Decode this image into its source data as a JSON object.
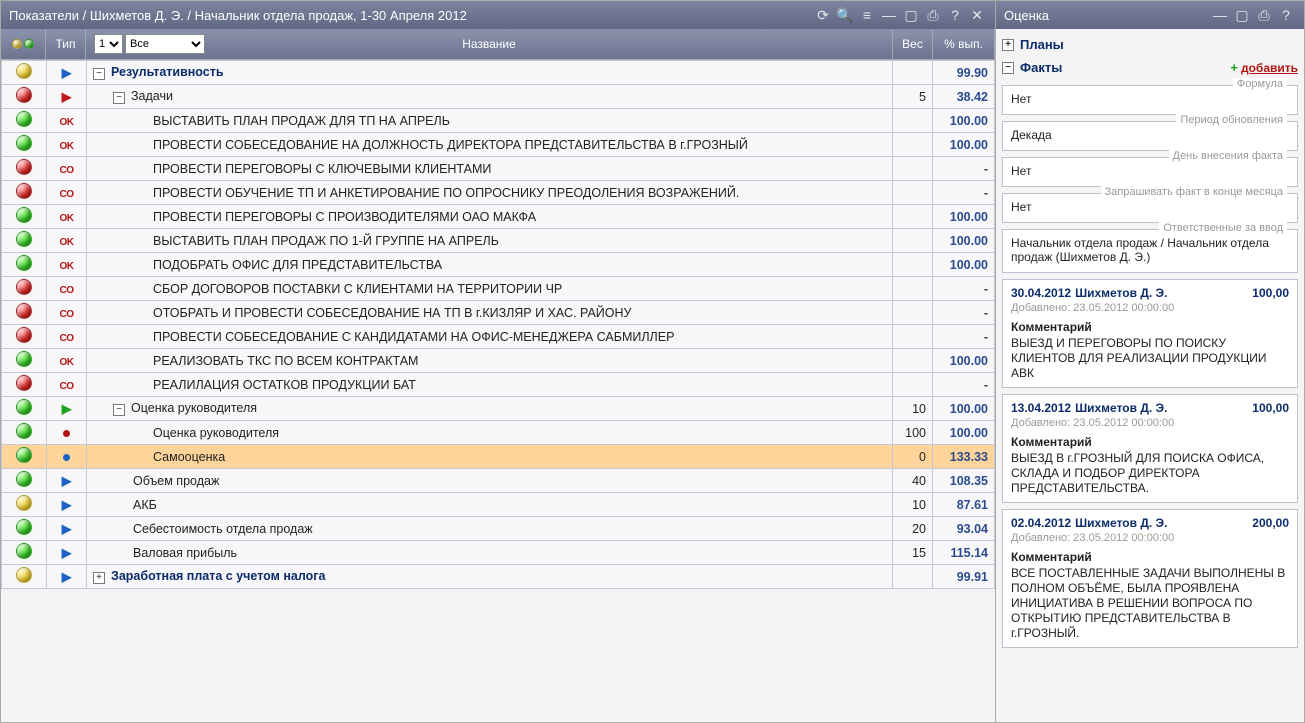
{
  "left_title": "Показатели / Шихметов Д. Э. / Начальник отдела продаж, 1-30 Апреля 2012",
  "right_title": "Оценка",
  "columns": {
    "type": "Тип",
    "name": "Название",
    "weight": "Вес",
    "pct": "% вып."
  },
  "level_select": "1",
  "filter_select": "Все",
  "plans_label": "Планы",
  "facts_label": "Факты",
  "add_link": "добавить",
  "fields": {
    "formula_label": "Формула",
    "formula_value": "Нет",
    "period_label": "Период обновления",
    "period_value": "Декада",
    "entryday_label": "День внесения факта",
    "entryday_value": "Нет",
    "eom_label": "Запрашивать факт в конце месяца",
    "eom_value": "Нет",
    "resp_label": "Ответственные за ввод",
    "resp_value": "Начальник отдела продаж / Начальник отдела продаж (Шихметов Д. Э.)"
  },
  "comment_label": "Комментарий",
  "entries": [
    {
      "date": "30.04.2012",
      "name": "Шихметов Д. Э.",
      "amount": "100,00",
      "added": "Добавлено: 23.05.2012 00:00:00",
      "comment": "ВЫЕЗД И ПЕРЕГОВОРЫ ПО ПОИСКУ КЛИЕНТОВ ДЛЯ РЕАЛИЗАЦИИ ПРОДУКЦИИ АВК"
    },
    {
      "date": "13.04.2012",
      "name": "Шихметов Д. Э.",
      "amount": "100,00",
      "added": "Добавлено: 23.05.2012 00:00:00",
      "comment": "ВЫЕЗД В г.ГРОЗНЫЙ ДЛЯ ПОИСКА ОФИСА, СКЛАДА И ПОДБОР ДИРЕКТОРА ПРЕДСТАВИТЕЛЬСТВА."
    },
    {
      "date": "02.04.2012",
      "name": "Шихметов Д. Э.",
      "amount": "200,00",
      "added": "Добавлено: 23.05.2012 00:00:00",
      "comment": "ВСЕ ПОСТАВЛЕННЫЕ ЗАДАЧИ ВЫПОЛНЕНЫ В ПОЛНОМ ОБЪЁМЕ, БЫЛА ПРОЯВЛЕНА ИНИЦИАТИВА В РЕШЕНИИ ВОПРОСА ПО ОТКРЫТИЮ ПРЕДСТАВИТЕЛЬСТВА В г.ГРОЗНЫЙ."
    }
  ],
  "rows": [
    {
      "dot": "yellow",
      "type": "play-blue",
      "indent": 0,
      "expander": "minus",
      "bold": true,
      "name": "Результативность",
      "weight": "",
      "pct": "99.90"
    },
    {
      "dot": "red",
      "type": "play-red",
      "indent": 1,
      "expander": "minus",
      "bold": false,
      "name": "Задачи",
      "weight": "5",
      "pct": "38.42"
    },
    {
      "dot": "green",
      "type": "ok",
      "indent": 3,
      "expander": "",
      "bold": false,
      "name": "ВЫСТАВИТЬ ПЛАН ПРОДАЖ ДЛЯ ТП НА АПРЕЛЬ",
      "weight": "",
      "pct": "100.00"
    },
    {
      "dot": "green",
      "type": "ok",
      "indent": 3,
      "expander": "",
      "bold": false,
      "name": "ПРОВЕСТИ СОБЕСЕДОВАНИЕ НА ДОЛЖНОСТЬ ДИРЕКТОРА ПРЕДСТАВИТЕЛЬСТВА В г.ГРОЗНЫЙ",
      "weight": "",
      "pct": "100.00"
    },
    {
      "dot": "red",
      "type": "so",
      "indent": 3,
      "expander": "",
      "bold": false,
      "name": "ПРОВЕСТИ ПЕРЕГОВОРЫ С КЛЮЧЕВЫМИ КЛИЕНТАМИ",
      "weight": "",
      "pct": "-"
    },
    {
      "dot": "red",
      "type": "so",
      "indent": 3,
      "expander": "",
      "bold": false,
      "name": "ПРОВЕСТИ ОБУЧЕНИЕ ТП И АНКЕТИРОВАНИЕ ПО ОПРОСНИКУ ПРЕОДОЛЕНИЯ ВОЗРАЖЕНИЙ.",
      "weight": "",
      "pct": "-"
    },
    {
      "dot": "green",
      "type": "ok",
      "indent": 3,
      "expander": "",
      "bold": false,
      "name": "ПРОВЕСТИ ПЕРЕГОВОРЫ С ПРОИЗВОДИТЕЛЯМИ ОАО МАКФА",
      "weight": "",
      "pct": "100.00"
    },
    {
      "dot": "green",
      "type": "ok",
      "indent": 3,
      "expander": "",
      "bold": false,
      "name": "ВЫСТАВИТЬ ПЛАН ПРОДАЖ ПО 1-Й ГРУППЕ НА АПРЕЛЬ",
      "weight": "",
      "pct": "100.00"
    },
    {
      "dot": "green",
      "type": "ok",
      "indent": 3,
      "expander": "",
      "bold": false,
      "name": "ПОДОБРАТЬ ОФИС ДЛЯ ПРЕДСТАВИТЕЛЬСТВА",
      "weight": "",
      "pct": "100.00"
    },
    {
      "dot": "red",
      "type": "so",
      "indent": 3,
      "expander": "",
      "bold": false,
      "name": "СБОР ДОГОВОРОВ ПОСТАВКИ С КЛИЕНТАМИ НА ТЕРРИТОРИИ ЧР",
      "weight": "",
      "pct": "-"
    },
    {
      "dot": "red",
      "type": "so",
      "indent": 3,
      "expander": "",
      "bold": false,
      "name": "ОТОБРАТЬ И ПРОВЕСТИ СОБЕСЕДОВАНИЕ НА ТП В г.КИЗЛЯР И ХАС. РАЙОНУ",
      "weight": "",
      "pct": "-"
    },
    {
      "dot": "red",
      "type": "so",
      "indent": 3,
      "expander": "",
      "bold": false,
      "name": "ПРОВЕСТИ СОБЕСЕДОВАНИЕ С КАНДИДАТАМИ НА ОФИС-МЕНЕДЖЕРА САБМИЛЛЕР",
      "weight": "",
      "pct": "-"
    },
    {
      "dot": "green",
      "type": "ok",
      "indent": 3,
      "expander": "",
      "bold": false,
      "name": "РЕАЛИЗОВАТЬ ТКС ПО ВСЕМ КОНТРАКТАМ",
      "weight": "",
      "pct": "100.00"
    },
    {
      "dot": "red",
      "type": "so",
      "indent": 3,
      "expander": "",
      "bold": false,
      "name": "РЕАЛИЛАЦИЯ ОСТАТКОВ ПРОДУКЦИИ БАТ",
      "weight": "",
      "pct": "-"
    },
    {
      "dot": "green",
      "type": "play-green",
      "indent": 1,
      "expander": "minus",
      "bold": false,
      "name": "Оценка руководителя",
      "weight": "10",
      "pct": "100.00"
    },
    {
      "dot": "green",
      "type": "dot-red",
      "indent": 3,
      "expander": "",
      "bold": false,
      "name": "Оценка руководителя",
      "weight": "100",
      "pct": "100.00"
    },
    {
      "dot": "green",
      "type": "dot-blue",
      "indent": 3,
      "expander": "",
      "bold": false,
      "name": "Самооценка",
      "weight": "0",
      "pct": "133.33",
      "selected": true
    },
    {
      "dot": "green",
      "type": "play-blue",
      "indent": 2,
      "expander": "",
      "bold": false,
      "name": "Объем продаж",
      "weight": "40",
      "pct": "108.35"
    },
    {
      "dot": "yellow",
      "type": "play-blue",
      "indent": 2,
      "expander": "",
      "bold": false,
      "name": "АКБ",
      "weight": "10",
      "pct": "87.61"
    },
    {
      "dot": "green",
      "type": "play-blue",
      "indent": 2,
      "expander": "",
      "bold": false,
      "name": "Себестоимость отдела продаж",
      "weight": "20",
      "pct": "93.04"
    },
    {
      "dot": "green",
      "type": "play-blue",
      "indent": 2,
      "expander": "",
      "bold": false,
      "name": "Валовая прибыль",
      "weight": "15",
      "pct": "115.14"
    },
    {
      "dot": "yellow",
      "type": "play-blue",
      "indent": 0,
      "expander": "plus",
      "bold": true,
      "name": "Заработная плата с учетом налога",
      "weight": "",
      "pct": "99.91"
    }
  ]
}
